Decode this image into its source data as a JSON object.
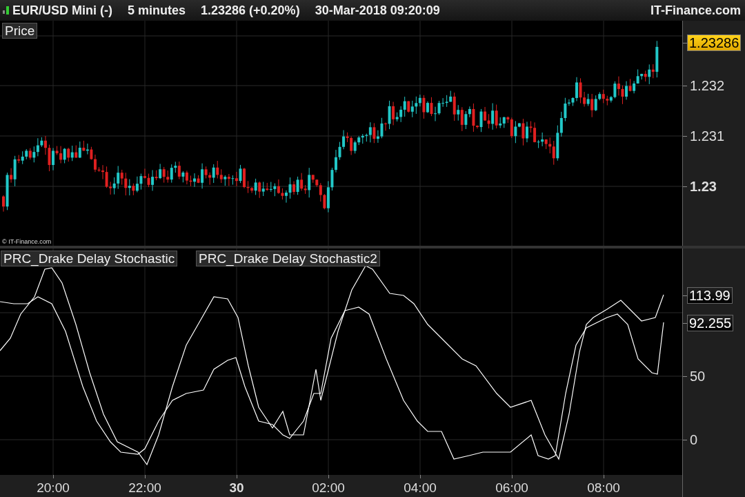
{
  "header": {
    "symbol": "EUR/USD Mini (-)",
    "interval": "5 minutes",
    "quote": "1.23286 (+0.20%)",
    "datetime": "30-Mar-2018 09:20:09",
    "brand": "IT-Finance.com"
  },
  "price_panel": {
    "title": "Price",
    "watermark": "© IT-Finance.com",
    "price_tag": "1.23286",
    "axis_labels": [
      {
        "label": "1.232",
        "bold": false
      },
      {
        "label": "1.231",
        "bold": false
      },
      {
        "label": "1.23",
        "bold": true
      }
    ]
  },
  "indicator_panel": {
    "legends": [
      "PRC_Drake Delay Stochastic",
      "PRC_Drake Delay Stochastic2"
    ],
    "value_tags": [
      "113.99",
      "92.255"
    ],
    "axis_labels": [
      {
        "label": "50",
        "bold": false
      },
      {
        "label": "0",
        "bold": false
      }
    ]
  },
  "time_axis": [
    {
      "label": "20:00",
      "bold": false
    },
    {
      "label": "22:00",
      "bold": false
    },
    {
      "label": "30",
      "bold": true
    },
    {
      "label": "02:00",
      "bold": false
    },
    {
      "label": "04:00",
      "bold": false
    },
    {
      "label": "06:00",
      "bold": false
    },
    {
      "label": "08:00",
      "bold": false
    }
  ]
}
